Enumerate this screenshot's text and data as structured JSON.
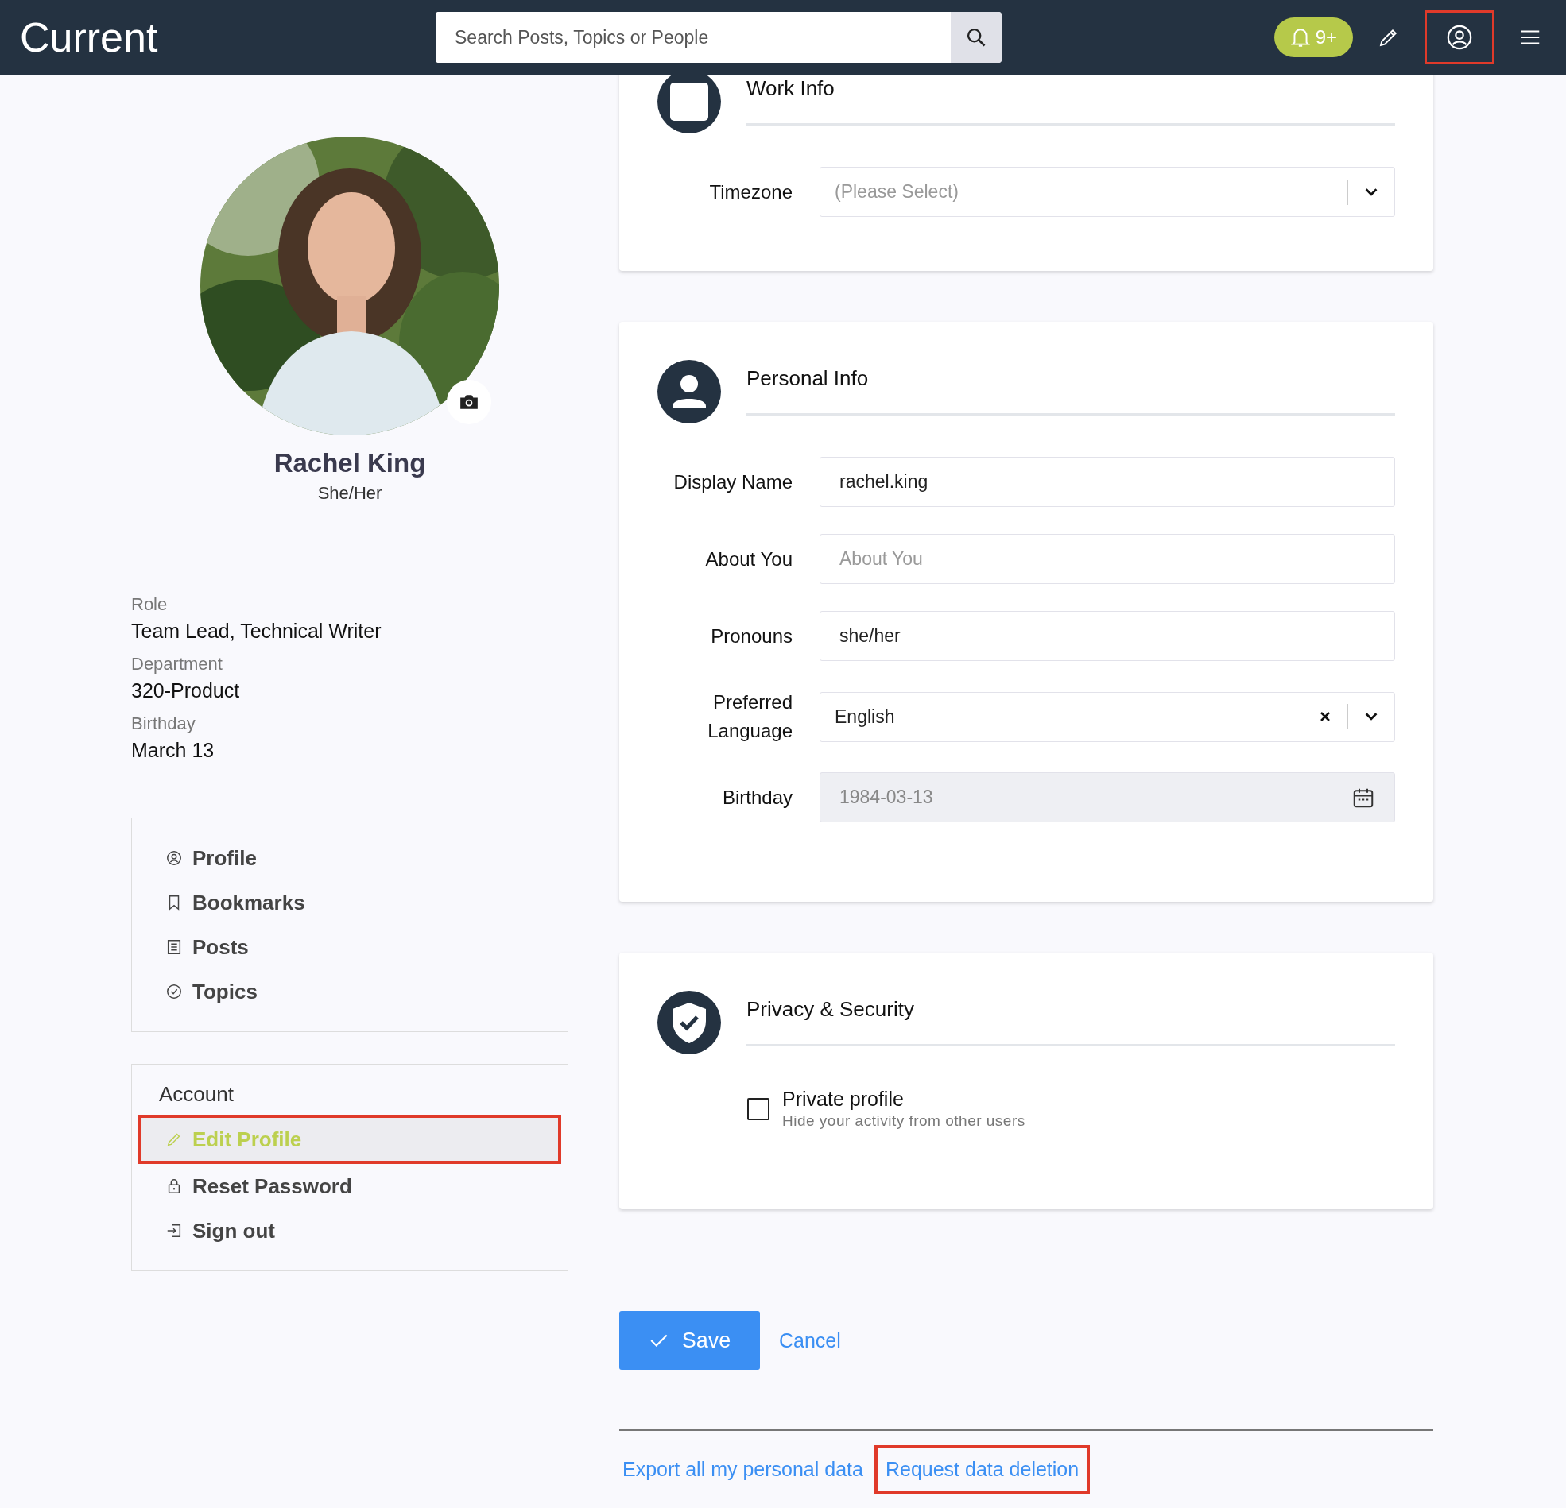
{
  "header": {
    "logo": "Current",
    "search": {
      "placeholder": "Search Posts, Topics or People"
    },
    "notifications": {
      "count": "9+"
    },
    "profile_button": {
      "highlighted": true
    }
  },
  "profile": {
    "name": "Rachel King",
    "pronouns": "She/Her",
    "details": [
      {
        "label": "Role",
        "value": "Team Lead, Technical Writer"
      },
      {
        "label": "Department",
        "value": "320-Product"
      },
      {
        "label": "Birthday",
        "value": "March 13"
      }
    ]
  },
  "nav": [
    {
      "label": "Profile",
      "selected": false
    },
    {
      "label": "Bookmarks",
      "selected": false
    },
    {
      "label": "Posts",
      "selected": false
    },
    {
      "label": "Topics",
      "selected": false
    }
  ],
  "account": {
    "title": "Account",
    "items": [
      {
        "label": "Edit Profile",
        "selected": true,
        "highlighted": true
      },
      {
        "label": "Reset Password",
        "selected": false,
        "highlighted": false
      },
      {
        "label": "Sign out",
        "selected": false,
        "highlighted": false
      }
    ]
  },
  "sections": [
    {
      "title": "Work Info",
      "fields": [
        {
          "label": "Timezone",
          "kind": "select",
          "placeholder": "(Please Select)"
        }
      ]
    },
    {
      "title": "Personal Info",
      "fields": [
        {
          "label": "Display Name",
          "kind": "text",
          "value": "rachel.king"
        },
        {
          "label": "About You",
          "kind": "text",
          "placeholder": "About You"
        },
        {
          "label": "Pronouns",
          "kind": "text",
          "value": "she/her"
        },
        {
          "label": "Preferred Language",
          "kind": "select",
          "value": "English",
          "clearable": true
        },
        {
          "label": "Birthday",
          "kind": "date",
          "value": "1984-03-13",
          "disabled": true
        }
      ]
    },
    {
      "title": "Privacy & Security",
      "fields": [
        {
          "label": "Private profile",
          "kind": "checkbox",
          "hint": "Hide your activity from other users",
          "checked": false
        }
      ]
    }
  ],
  "actions": {
    "save": "Save",
    "cancel": "Cancel"
  },
  "footer_links": [
    {
      "label": "Export all my personal data",
      "highlighted": false
    },
    {
      "label": "Request data deletion",
      "highlighted": true
    }
  ]
}
